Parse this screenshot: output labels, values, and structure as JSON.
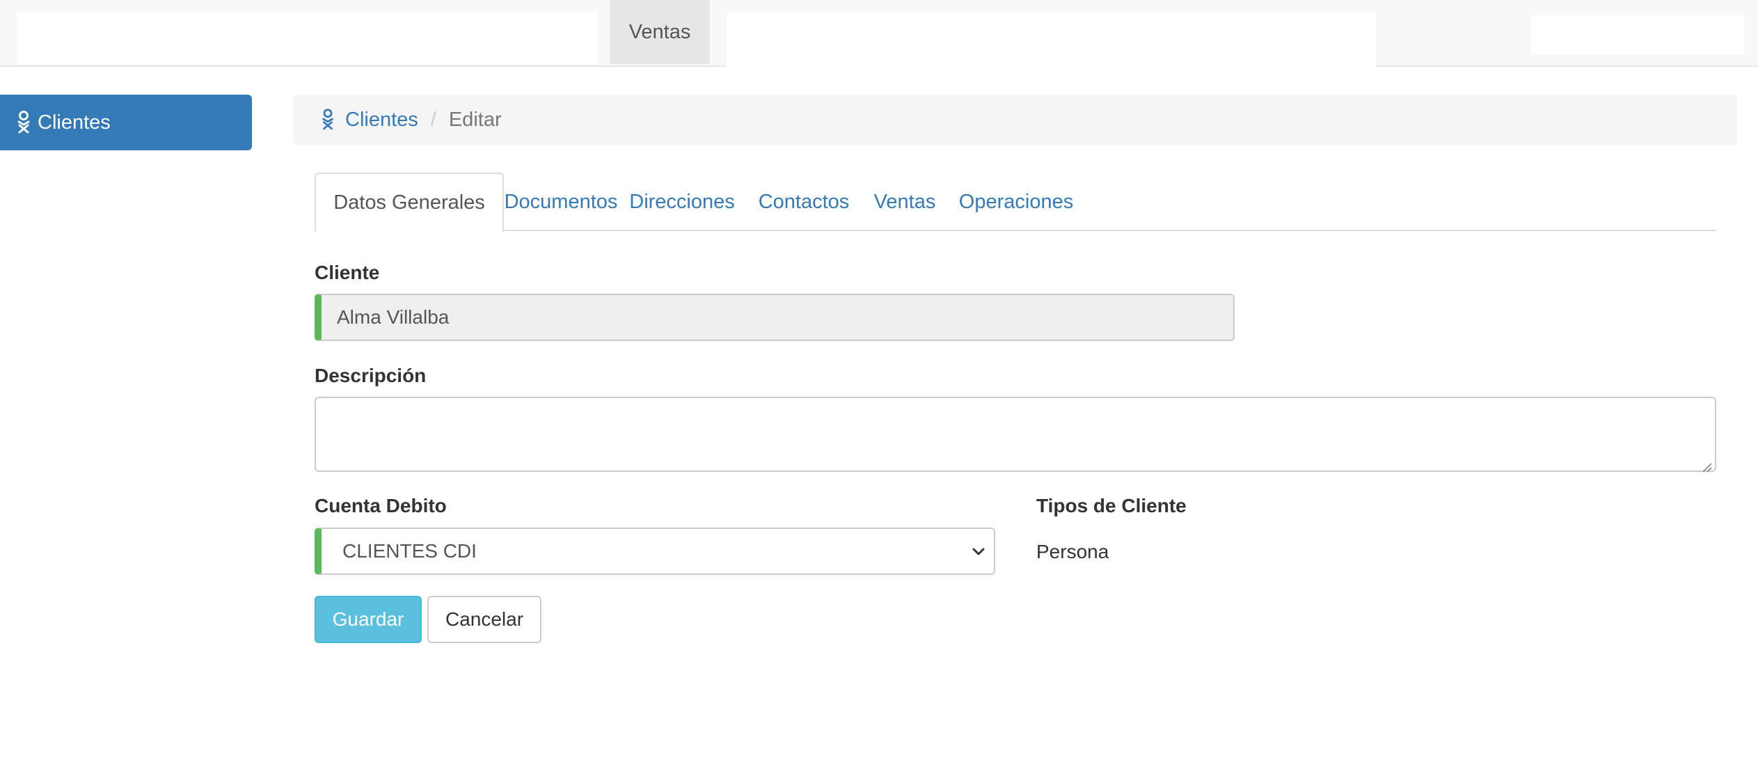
{
  "navbar": {
    "active_tab": "Ventas"
  },
  "sidebar": {
    "items": [
      {
        "label": "Clientes",
        "icon": "person-icon"
      }
    ]
  },
  "breadcrumb": {
    "icon": "person-icon",
    "link": "Clientes",
    "separator": "/",
    "current": "Editar"
  },
  "tabs": [
    {
      "label": "Datos Generales",
      "active": true
    },
    {
      "label": "Documentos"
    },
    {
      "label": "Direcciones"
    },
    {
      "label": "Contactos"
    },
    {
      "label": "Ventas"
    },
    {
      "label": "Operaciones"
    }
  ],
  "form": {
    "cliente_label": "Cliente",
    "cliente_value": "Alma Villalba",
    "descripcion_label": "Descripción",
    "descripcion_value": "",
    "cuenta_label": "Cuenta Debito",
    "cuenta_value": "CLIENTES CDI",
    "tipos_label": "Tipos de Cliente",
    "tipos_value": "Persona",
    "save_label": "Guardar",
    "cancel_label": "Cancelar"
  },
  "colors": {
    "primary": "#337ab7",
    "info": "#5bc0de",
    "success_border": "#5cb85c"
  }
}
